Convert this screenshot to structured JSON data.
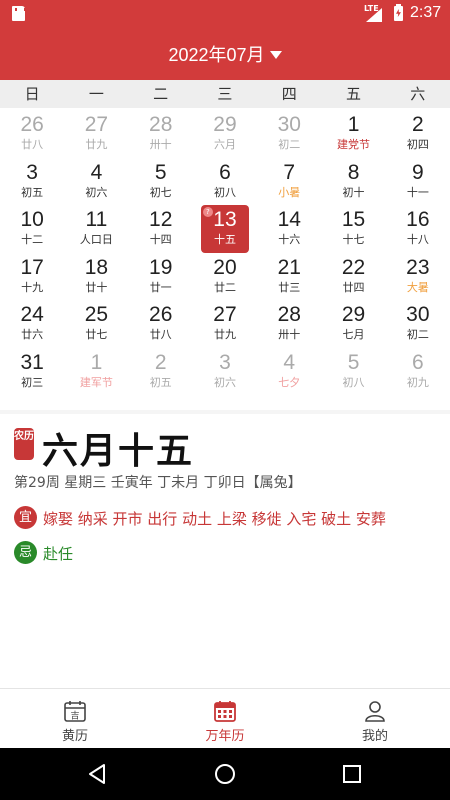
{
  "status_bar": {
    "network": "LTE",
    "time": "2:37"
  },
  "header": {
    "title": "2022年07月"
  },
  "weekdays": [
    "日",
    "一",
    "二",
    "三",
    "四",
    "五",
    "六"
  ],
  "calendar": {
    "rows": [
      [
        {
          "day": "26",
          "lunar": "廿八",
          "type": "other"
        },
        {
          "day": "27",
          "lunar": "廿九",
          "type": "other"
        },
        {
          "day": "28",
          "lunar": "卅十",
          "type": "other"
        },
        {
          "day": "29",
          "lunar": "六月",
          "type": "other"
        },
        {
          "day": "30",
          "lunar": "初二",
          "type": "other"
        },
        {
          "day": "1",
          "lunar": "建党节",
          "type": "holiday"
        },
        {
          "day": "2",
          "lunar": "初四",
          "type": "normal"
        }
      ],
      [
        {
          "day": "3",
          "lunar": "初五",
          "type": "normal"
        },
        {
          "day": "4",
          "lunar": "初六",
          "type": "normal"
        },
        {
          "day": "5",
          "lunar": "初七",
          "type": "normal"
        },
        {
          "day": "6",
          "lunar": "初八",
          "type": "normal"
        },
        {
          "day": "7",
          "lunar": "小暑",
          "type": "term"
        },
        {
          "day": "8",
          "lunar": "初十",
          "type": "normal"
        },
        {
          "day": "9",
          "lunar": "十一",
          "type": "normal"
        }
      ],
      [
        {
          "day": "10",
          "lunar": "十二",
          "type": "normal"
        },
        {
          "day": "11",
          "lunar": "人口日",
          "type": "normal"
        },
        {
          "day": "12",
          "lunar": "十四",
          "type": "normal"
        },
        {
          "day": "13",
          "lunar": "十五",
          "type": "today"
        },
        {
          "day": "14",
          "lunar": "十六",
          "type": "normal"
        },
        {
          "day": "15",
          "lunar": "十七",
          "type": "normal"
        },
        {
          "day": "16",
          "lunar": "十八",
          "type": "normal"
        }
      ],
      [
        {
          "day": "17",
          "lunar": "十九",
          "type": "normal"
        },
        {
          "day": "18",
          "lunar": "廿十",
          "type": "normal"
        },
        {
          "day": "19",
          "lunar": "廿一",
          "type": "normal"
        },
        {
          "day": "20",
          "lunar": "廿二",
          "type": "normal"
        },
        {
          "day": "21",
          "lunar": "廿三",
          "type": "normal"
        },
        {
          "day": "22",
          "lunar": "廿四",
          "type": "normal"
        },
        {
          "day": "23",
          "lunar": "大暑",
          "type": "term"
        }
      ],
      [
        {
          "day": "24",
          "lunar": "廿六",
          "type": "normal"
        },
        {
          "day": "25",
          "lunar": "廿七",
          "type": "normal"
        },
        {
          "day": "26",
          "lunar": "廿八",
          "type": "normal"
        },
        {
          "day": "27",
          "lunar": "廿九",
          "type": "normal"
        },
        {
          "day": "28",
          "lunar": "卅十",
          "type": "normal"
        },
        {
          "day": "29",
          "lunar": "七月",
          "type": "normal"
        },
        {
          "day": "30",
          "lunar": "初二",
          "type": "normal"
        }
      ],
      [
        {
          "day": "31",
          "lunar": "初三",
          "type": "normal"
        },
        {
          "day": "1",
          "lunar": "建军节",
          "type": "other-holiday"
        },
        {
          "day": "2",
          "lunar": "初五",
          "type": "other"
        },
        {
          "day": "3",
          "lunar": "初六",
          "type": "other"
        },
        {
          "day": "4",
          "lunar": "七夕",
          "type": "other-holiday"
        },
        {
          "day": "5",
          "lunar": "初八",
          "type": "other"
        },
        {
          "day": "6",
          "lunar": "初九",
          "type": "other"
        }
      ]
    ]
  },
  "detail": {
    "nongli_badge": "农历",
    "lunar_date": "六月十五",
    "info": "第29周 星期三 壬寅年 丁未月 丁卯日【属兔】",
    "yi_label": "宜",
    "yi_items": "嫁娶 纳采 开市 出行 动土 上梁 移徙 入宅 破土 安葬",
    "ji_label": "忌",
    "ji_items": "赴任"
  },
  "tabs": [
    {
      "label": "黄历",
      "icon": "almanac-icon",
      "active": false
    },
    {
      "label": "万年历",
      "icon": "calendar-icon",
      "active": true
    },
    {
      "label": "我的",
      "icon": "profile-icon",
      "active": false
    }
  ],
  "colors": {
    "primary_red": "#d23b3b",
    "today_red": "#c73737",
    "holiday_red": "#c73737",
    "solar_term_orange": "#f0a040",
    "ji_green": "#2a8a2a"
  },
  "calendar_icon_text": "吉"
}
